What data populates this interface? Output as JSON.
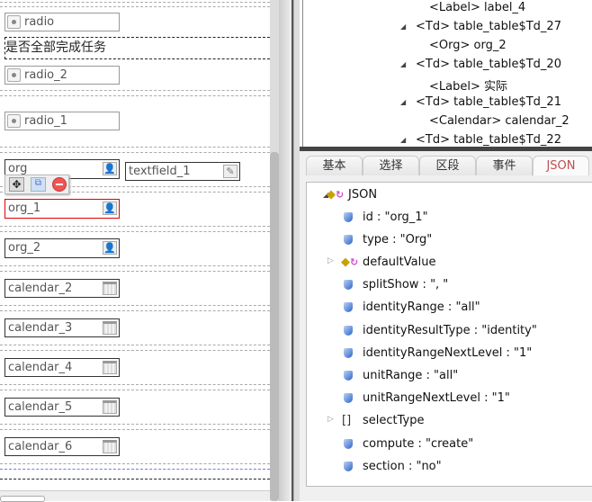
{
  "canvas": {
    "label_text": "是否全部完成任务",
    "radios": [
      "radio",
      "radio_2",
      "radio_1"
    ],
    "orgs": [
      "org",
      "org_1",
      "org_2"
    ],
    "textfield": "textfield_1",
    "calendars": [
      "calendar_2",
      "calendar_3",
      "calendar_4",
      "calendar_5",
      "calendar_6"
    ]
  },
  "tree": {
    "items": [
      {
        "text": "<Label> label_4"
      },
      {
        "text": "<Td> table_table$Td_27"
      },
      {
        "text": "<Org> org_2"
      },
      {
        "text": "<Td> table_table$Td_20"
      },
      {
        "text": "<Label> 实际"
      },
      {
        "text": "<Td> table_table$Td_21"
      },
      {
        "text": "<Calendar> calendar_2"
      },
      {
        "text": "<Td> table_table$Td_22"
      }
    ]
  },
  "tabs": [
    "基本",
    "选择",
    "区段",
    "事件",
    "JSON"
  ],
  "json_tree": {
    "root": "JSON",
    "entries": [
      "id : \"org_1\"",
      "type : \"Org\"",
      "defaultValue",
      "splitShow : \", \"",
      "identityRange : \"all\"",
      "identityResultType : \"identity\"",
      "identityRangeNextLevel : \"1\"",
      "unitRange : \"all\"",
      "unitRangeNextLevel : \"1\"",
      "selectType",
      "compute : \"create\"",
      "section : \"no\""
    ]
  },
  "colors": {
    "selected_border": "#e00000",
    "active_tab": "#c05050"
  }
}
